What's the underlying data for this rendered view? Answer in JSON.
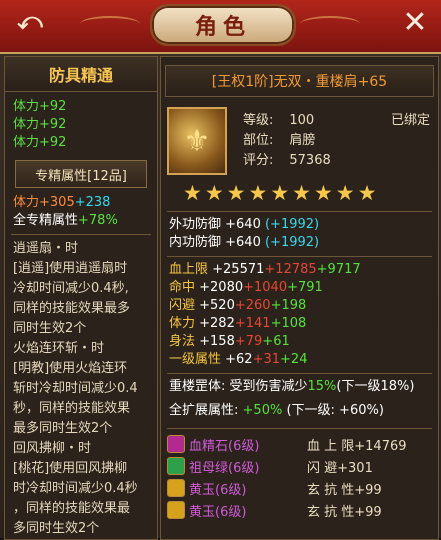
{
  "header": {
    "title": "角色",
    "back_glyph": "⤺",
    "close_glyph": "✕"
  },
  "left": {
    "title": "防具精通",
    "lines": [
      "体力+92",
      "体力+92",
      "体力+92"
    ],
    "section_label": "专精属性[12品]",
    "stat1_label": "体力",
    "stat1_base": "+305",
    "stat1_bonus": "+238",
    "stat2_label": "全专精属性",
    "stat2_value": "+78%",
    "desc": [
      "逍遥扇・时",
      "[逍遥]使用逍遥扇时",
      "冷却时间减少0.4秒,",
      "同样的技能效果最多",
      "同时生效2个",
      "火焰连环斩・时",
      "[明教]使用火焰连环",
      "斩时冷却时间减少0.4",
      "秒，同样的技能效果",
      "最多同时生效2个",
      "回风拂柳・时",
      "[桃花]使用回风拂柳",
      "时冷却时间减少0.4秒",
      "，同样的技能效果最",
      "多同时生效2个"
    ]
  },
  "item": {
    "name": "[王权1阶]无双・重楼肩+65",
    "level_label": "等级:",
    "level_value": "100",
    "bound": "已绑定",
    "part_label": "部位:",
    "part_value": "肩膀",
    "score_label": "评分:",
    "score_value": "57368",
    "stars": 9,
    "icon_name": "shoulder-armor-icon"
  },
  "defense": [
    {
      "label": "外功防御 +640",
      "bonus": "(+1992)"
    },
    {
      "label": "内功防御 +640",
      "bonus": "(+1992)"
    }
  ],
  "attributes": [
    {
      "label": "血上限",
      "base": "+25571",
      "red": "+12785",
      "green": "+9717"
    },
    {
      "label": "命中",
      "base": "+2080",
      "red": "+1040",
      "green": "+791"
    },
    {
      "label": "闪避",
      "base": "+520",
      "red": "+260",
      "green": "+198"
    },
    {
      "label": "体力",
      "base": "+282",
      "red": "+141",
      "green": "+108"
    },
    {
      "label": "身法",
      "base": "+158",
      "red": "+79",
      "green": "+61"
    },
    {
      "label": "一级属性",
      "base": "+62",
      "red": "+31",
      "green": "+24"
    }
  ],
  "bonus": {
    "line1_label": "重楼罡体: 受到伤害减少",
    "line1_value": "15%",
    "line1_next": "(下一级18%)",
    "line2_label": "全扩展属性:",
    "line2_value": "+50%",
    "line2_next": "(下一级: +60%)"
  },
  "gems": [
    {
      "name": "血精石(6级)",
      "stat": "血 上 限+14769",
      "color": "#d05bd8",
      "icon_color": "#b22a8f"
    },
    {
      "name": "祖母绿(6级)",
      "stat": "闪    避+301",
      "color": "#d05bd8",
      "icon_color": "#2ea04a"
    },
    {
      "name": "黄玉(6级)",
      "stat": "玄 抗 性+99",
      "color": "#d05bd8",
      "icon_color": "#d6a21e"
    },
    {
      "name": "黄玉(6级)",
      "stat": "玄 抗 性+99",
      "color": "#d05bd8",
      "icon_color": "#d6a21e"
    }
  ],
  "colors": {
    "header_red": "#9c1d14",
    "gold": "#f6c453",
    "green": "#55e33b",
    "cyan": "#37d7ee",
    "orange": "#ff8b3a"
  }
}
